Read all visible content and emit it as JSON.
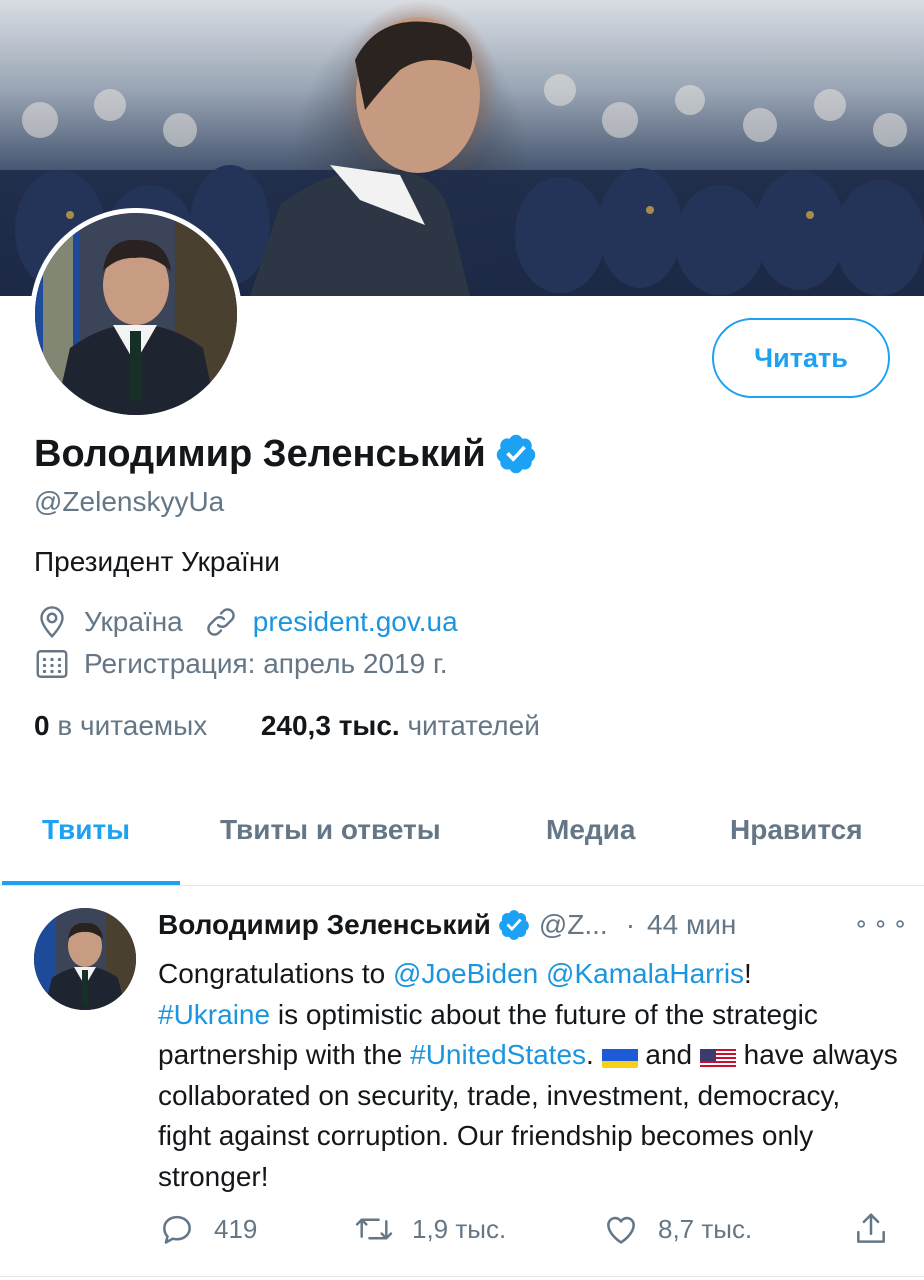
{
  "profile": {
    "follow_label": "Читать",
    "name": "Володимир Зеленський",
    "handle": "@ZelenskyyUa",
    "bio": "Президент України",
    "location": "Україна",
    "website": "president.gov.ua",
    "joined": "Регистрация: апрель 2019 г.",
    "following_count": "0",
    "following_label": "в читаемых",
    "followers_count": "240,3 тыс.",
    "followers_label": "читателей",
    "verified_icon": "verified-badge-icon"
  },
  "tabs": [
    {
      "label": "Твиты",
      "active": true
    },
    {
      "label": "Твиты и ответы",
      "active": false
    },
    {
      "label": "Медиа",
      "active": false
    },
    {
      "label": "Нравится",
      "active": false
    }
  ],
  "tweet": {
    "author": "Володимир Зеленський",
    "handle": "@Z...",
    "separator": "·",
    "time": "44 мин",
    "more": "⚬⚬⚬",
    "text_parts": {
      "p1": "Congratulations to ",
      "m1": "@JoeBiden",
      "p2": " ",
      "m2": "@KamalaHarris",
      "p3": "!",
      "h1": "#Ukraine",
      "p4": " is optimistic about the future of the strategic partnership with the ",
      "h2": "#UnitedStates",
      "p5": ". ",
      "p6": " and ",
      "p7": " have always collaborated on security, trade, investment, democracy, fight against corruption. Our friendship becomes only stronger!"
    },
    "replies": "419",
    "retweets": "1,9 тыс.",
    "likes": "8,7 тыс."
  },
  "colors": {
    "accent": "#1da1f2",
    "link": "#1b95e0",
    "secondary_text": "#657786",
    "primary_text": "#14171a"
  }
}
